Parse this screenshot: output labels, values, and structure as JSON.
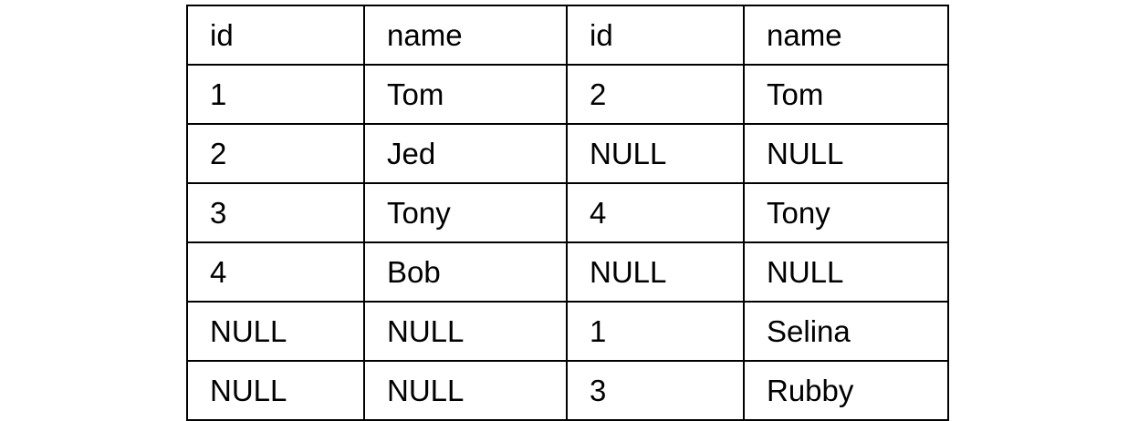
{
  "table": {
    "header": [
      "id",
      "name",
      "id",
      "name"
    ],
    "rows": [
      [
        "1",
        "Tom",
        "2",
        "Tom"
      ],
      [
        "2",
        "Jed",
        "NULL",
        "NULL"
      ],
      [
        "3",
        "Tony",
        "4",
        "Tony"
      ],
      [
        "4",
        "Bob",
        "NULL",
        "NULL"
      ],
      [
        "NULL",
        "NULL",
        "1",
        "Selina"
      ],
      [
        "NULL",
        "NULL",
        "3",
        "Rubby"
      ]
    ]
  }
}
